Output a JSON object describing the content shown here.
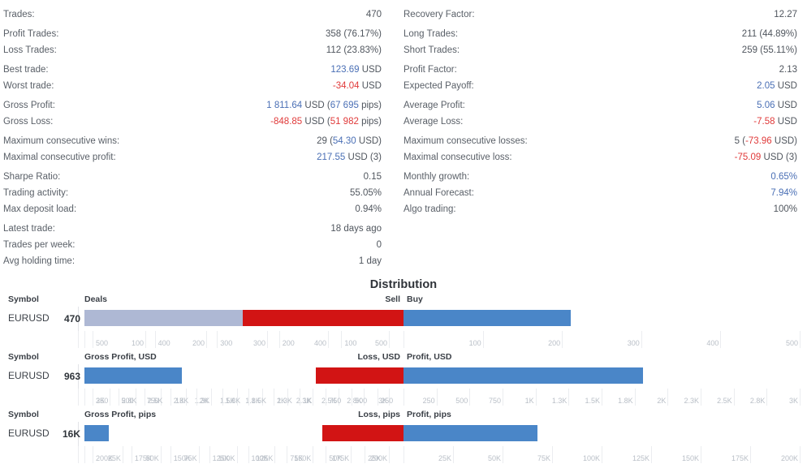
{
  "colors": {
    "positive": "#4a6fb5",
    "negative": "#e03a3a",
    "bar_deals": "#aeb8d4",
    "bar_buy": "#4a86c8",
    "bar_sell": "#d21414"
  },
  "stats": {
    "left": [
      {
        "label": "Trades:",
        "value": "470",
        "tone": "plain",
        "gap": false
      },
      {
        "label": "Profit Trades:",
        "value": "358 (76.17%)",
        "tone": "plain",
        "gap": true
      },
      {
        "label": "Loss Trades:",
        "value": "112 (23.83%)",
        "tone": "plain",
        "gap": false
      },
      {
        "label": "Best trade:",
        "value": "123.69",
        "suffix": " USD",
        "tone": "blue",
        "gap": true
      },
      {
        "label": "Worst trade:",
        "value": "-34.04",
        "suffix": " USD",
        "tone": "red",
        "gap": false
      },
      {
        "label": "Gross Profit:",
        "value": "1 811.64",
        "suffix": " USD (",
        "value2": "67 695",
        "suffix2": " pips)",
        "tone": "blue",
        "gap": true
      },
      {
        "label": "Gross Loss:",
        "value": "-848.85",
        "suffix": " USD (",
        "value2": "51 982",
        "suffix2": " pips)",
        "tone": "red",
        "gap": false
      },
      {
        "label": "Maximum consecutive wins:",
        "value": "29 (",
        "value2": "54.30",
        "suffix2": " USD)",
        "tone": "blue-inner",
        "gap": true
      },
      {
        "label": "Maximal consecutive profit:",
        "value": "217.55",
        "suffix": " USD (3)",
        "tone": "blue",
        "gap": false
      },
      {
        "label": "Sharpe Ratio:",
        "value": "0.15",
        "tone": "plain",
        "gap": true
      },
      {
        "label": "Trading activity:",
        "value": "55.05%",
        "tone": "plain",
        "gap": false
      },
      {
        "label": "Max deposit load:",
        "value": "0.94%",
        "tone": "plain",
        "gap": false
      },
      {
        "label": "Latest trade:",
        "value": "18 days ago",
        "tone": "plain",
        "gap": true
      },
      {
        "label": "Trades per week:",
        "value": "0",
        "tone": "plain",
        "gap": false
      },
      {
        "label": "Avg holding time:",
        "value": "1 day",
        "tone": "plain",
        "gap": false
      }
    ],
    "right": [
      {
        "label": "Recovery Factor:",
        "value": "12.27",
        "tone": "plain",
        "gap": false
      },
      {
        "label": "Long Trades:",
        "value": "211 (44.89%)",
        "tone": "plain",
        "gap": true
      },
      {
        "label": "Short Trades:",
        "value": "259 (55.11%)",
        "tone": "plain",
        "gap": false
      },
      {
        "label": "Profit Factor:",
        "value": "2.13",
        "tone": "plain",
        "gap": true
      },
      {
        "label": "Expected Payoff:",
        "value": "2.05",
        "suffix": " USD",
        "tone": "blue",
        "gap": false
      },
      {
        "label": "Average Profit:",
        "value": "5.06",
        "suffix": " USD",
        "tone": "blue",
        "gap": true
      },
      {
        "label": "Average Loss:",
        "value": "-7.58",
        "suffix": " USD",
        "tone": "red",
        "gap": false
      },
      {
        "label": "Maximum consecutive losses:",
        "value": "5 (",
        "value2": "-73.96",
        "suffix2": " USD)",
        "tone": "red-inner",
        "gap": true
      },
      {
        "label": "Maximal consecutive loss:",
        "value": "-75.09",
        "suffix": " USD (3)",
        "tone": "red",
        "gap": false
      },
      {
        "label": "Monthly growth:",
        "value": "0.65%",
        "tone": "blue",
        "gap": true
      },
      {
        "label": "Annual Forecast:",
        "value": "7.94%",
        "tone": "blue",
        "gap": false
      },
      {
        "label": "Algo trading:",
        "value": "100%",
        "tone": "plain",
        "gap": false
      }
    ]
  },
  "distribution": {
    "title": "Distribution",
    "symbol_header": "Symbol",
    "rows": [
      {
        "id": "deals",
        "left_series_label": "Deals",
        "neg_label": "Sell",
        "pos_label": "Buy",
        "symbol": "EURUSD",
        "value_label": "470",
        "left_value": 470,
        "neg_value": 259,
        "pos_value": 211,
        "left_axis_max": 500,
        "split_axis_max": 500,
        "left_ticks": [
          "100",
          "200",
          "300",
          "400",
          "500"
        ],
        "neg_ticks": [
          "500",
          "400",
          "300",
          "200",
          "100"
        ],
        "pos_ticks": [
          "100",
          "200",
          "300",
          "400",
          "500"
        ]
      },
      {
        "id": "gross-profit-usd",
        "left_series_label": "Gross Profit, USD",
        "neg_label": "Loss, USD",
        "pos_label": "Profit, USD",
        "symbol": "EURUSD",
        "value_label": "963",
        "left_value": 963,
        "neg_value": 848.85,
        "pos_value": 1811.64,
        "left_axis_max": 3000,
        "split_axis_max": 3000,
        "left_ticks": [
          "250",
          "500",
          "750",
          "1K",
          "1.3K",
          "1.5K",
          "1.8K",
          "2K",
          "2.3K",
          "2.5K",
          "2.8K",
          "3K"
        ],
        "neg_ticks": [
          "3K",
          "2.8K",
          "2.5K",
          "2.3K",
          "2K",
          "1.8K",
          "1.5K",
          "1.3K",
          "1K",
          "750",
          "500",
          "250"
        ],
        "pos_ticks": [
          "250",
          "500",
          "750",
          "1K",
          "1.3K",
          "1.5K",
          "1.8K",
          "2K",
          "2.3K",
          "2.5K",
          "2.8K",
          "3K"
        ]
      },
      {
        "id": "gross-profit-pips",
        "left_series_label": "Gross Profit, pips",
        "neg_label": "Loss, pips",
        "pos_label": "Profit, pips",
        "symbol": "EURUSD",
        "value_label": "16K",
        "left_value": 16000,
        "neg_value": 51982,
        "pos_value": 67695,
        "left_axis_max": 200000,
        "split_axis_max": 200000,
        "left_ticks": [
          "25K",
          "50K",
          "75K",
          "100K",
          "125K",
          "150K",
          "175K",
          "200K"
        ],
        "neg_ticks": [
          "200K",
          "175K",
          "150K",
          "125K",
          "100K",
          "75K",
          "50K",
          "25K"
        ],
        "pos_ticks": [
          "25K",
          "50K",
          "75K",
          "100K",
          "125K",
          "150K",
          "175K",
          "200K"
        ]
      }
    ]
  }
}
